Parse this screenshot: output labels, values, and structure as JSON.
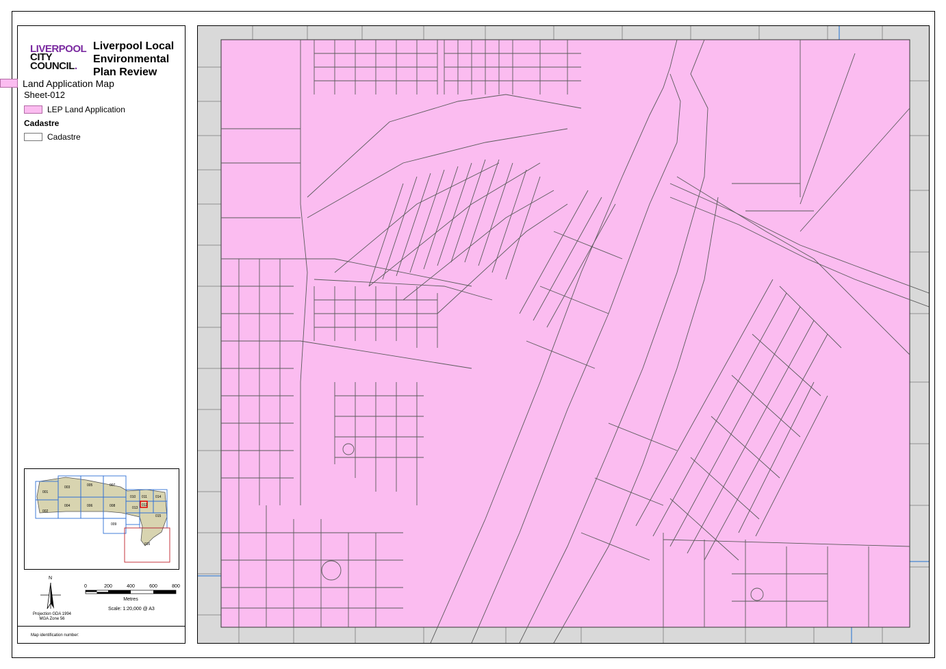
{
  "branding": {
    "logo_line1": "LIVERPOOL",
    "logo_line2": "CITY",
    "logo_line3": "COUNCIL",
    "title_line1": "Liverpool Local",
    "title_line2": "Environmental",
    "title_line3": "Plan Review"
  },
  "legend": {
    "map_name": "Land Application Map",
    "sheet": "Sheet-012",
    "items": [
      {
        "label": "LEP Land Application",
        "color": "#fbbcf0"
      },
      {
        "label": "Cadastre",
        "color": "#ffffff"
      }
    ],
    "group_heading": "Cadastre"
  },
  "overview": {
    "sheets": [
      "001",
      "002",
      "003",
      "004",
      "005",
      "006",
      "007",
      "008",
      "009",
      "010",
      "011",
      "012",
      "013",
      "014",
      "015",
      "016"
    ],
    "current_sheet": "012"
  },
  "scale": {
    "ticks": [
      "0",
      "200",
      "400",
      "600",
      "800"
    ],
    "units": "Metres",
    "scale_text": "Scale: 1:20,000 @ A3",
    "north_label": "N"
  },
  "projection": {
    "line1": "Projection GDA 1994",
    "line2": "MGA Zone 56"
  },
  "footer": {
    "map_ident": "Map identification number:"
  },
  "colors": {
    "land_application": "#fbbcf0",
    "outside": "#d9d9d9",
    "parcel_line": "#5a5a5a",
    "water_line": "#1f6fd1"
  }
}
